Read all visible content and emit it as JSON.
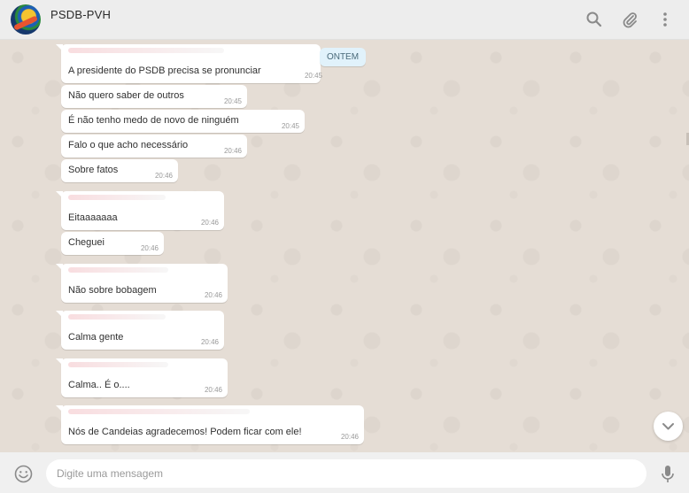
{
  "header": {
    "chat_name": "PSDB-PVH",
    "icons": [
      "search-icon",
      "paperclip-icon",
      "kebab-menu-icon"
    ]
  },
  "date_divider": "ONTEM",
  "messages": [
    {
      "text": "A presidente do PSDB precisa se pronunciar",
      "time": "20:45"
    },
    {
      "text": "Não quero saber de outros",
      "time": "20:45"
    },
    {
      "text": "É não tenho medo de novo de ninguém",
      "time": "20:45"
    },
    {
      "text": "Falo o que acho necessário",
      "time": "20:46"
    },
    {
      "text": "Sobre fatos",
      "time": "20:46"
    },
    {
      "text": "Eitaaaaaaa",
      "time": "20:46"
    },
    {
      "text": "Cheguei",
      "time": "20:46"
    },
    {
      "text": "Não sobre bobagem",
      "time": "20:46"
    },
    {
      "text": "Calma gente",
      "time": "20:46"
    },
    {
      "text": "Calma.. É o....",
      "time": "20:46"
    },
    {
      "text": "Nós de Candeias agradecemos! Podem ficar com ele!",
      "time": "20:46"
    }
  ],
  "composer": {
    "placeholder": "Digite uma mensagem",
    "icons": [
      "emoji-icon",
      "microphone-icon"
    ]
  },
  "colors": {
    "chat_background": "#e5ddd5",
    "bubble": "#ffffff",
    "date_pill": "#e1f2fb",
    "header": "#ededed"
  }
}
